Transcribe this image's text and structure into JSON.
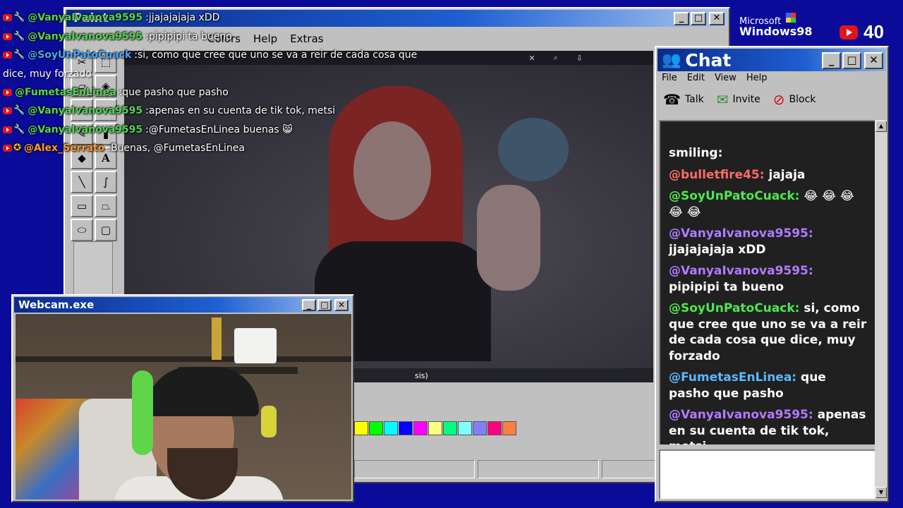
{
  "paint": {
    "title": "Paint",
    "menu": [
      "Colors",
      "Help",
      "Extras"
    ],
    "stream_caption": "sis)",
    "palette": [
      "#ffff00",
      "#00ff00",
      "#00ffff",
      "#0000ff",
      "#ff00ff",
      "#ffff80",
      "#00ff80",
      "#80ffff",
      "#8080ff",
      "#ff0080",
      "#ff8040"
    ]
  },
  "overlay_chat": [
    {
      "user": "@VanyaIvanova9595",
      "msg": "jjajajajaja xDD",
      "user_color": "#54d454",
      "icons": [
        "youtube",
        "wrench"
      ]
    },
    {
      "user": "@VanyaIvanova9595",
      "msg": "pipipipi ta bueno",
      "user_color": "#54d454",
      "icons": [
        "youtube",
        "wrench"
      ]
    },
    {
      "user": "@SoyUnPatoCuack",
      "msg": "si, como que cree que uno se va a reir de cada cosa que",
      "user_color": "#4aa8ff",
      "icons": [
        "youtube",
        "wrench"
      ]
    },
    {
      "continuation": "dice, muy forzado"
    },
    {
      "user": "@FumetasEnLinea",
      "msg": "que pasho que pasho",
      "user_color": "#54d454",
      "icons": [
        "youtube"
      ]
    },
    {
      "user": "@VanyaIvanova9595",
      "msg": "apenas en su cuenta de tik tok, metsi",
      "user_color": "#54d454",
      "icons": [
        "youtube",
        "wrench"
      ]
    },
    {
      "user": "@VanyaIvanova9595",
      "msg": "@FumetasEnLinea buenas 😸",
      "user_color": "#54d454",
      "icons": [
        "youtube",
        "wrench"
      ]
    },
    {
      "user": "@Alex_Serrato",
      "msg": "Buenas, @FumetasEnLinea",
      "user_color": "#ff9a30",
      "icons": [
        "youtube",
        "star"
      ]
    }
  ],
  "branding": {
    "microsoft": "Microsoft",
    "windows": "Windows98",
    "live_count": "40"
  },
  "chat_window": {
    "title": "Chat",
    "menu": [
      "File",
      "Edit",
      "View",
      "Help"
    ],
    "toolbar": [
      {
        "label": "Talk",
        "icon": "talk-icon"
      },
      {
        "label": "Invite",
        "icon": "invite-icon"
      },
      {
        "label": "Block",
        "icon": "block-icon"
      }
    ],
    "messages": [
      {
        "user": "",
        "msg": "smiling:"
      },
      {
        "user": "@bulletfire45:",
        "msg": "jajaja",
        "user_color": "#ff6a6a"
      },
      {
        "user": "@SoyUnPatoCuack:",
        "msg": "😂 😂 😂 😂 😂",
        "user_color": "#4ee84e"
      },
      {
        "user": "@VanyaIvanova9595:",
        "msg": "jjajajajaja xDD",
        "user_color": "#b07bff"
      },
      {
        "user": "@VanyaIvanova9595:",
        "msg": "pipipipi ta bueno",
        "user_color": "#b07bff"
      },
      {
        "user": "@SoyUnPatoCuack:",
        "msg": "si, como que cree que uno se va a reir de cada cosa que dice, muy forzado",
        "user_color": "#4ee84e"
      },
      {
        "user": "@FumetasEnLinea:",
        "msg": "que pasho que pasho",
        "user_color": "#5ab8ff"
      },
      {
        "user": "@VanyaIvanova9595:",
        "msg": "apenas en su cuenta de tik tok, metsi",
        "user_color": "#b07bff"
      }
    ]
  },
  "webcam": {
    "title": "Webcam.exe"
  }
}
